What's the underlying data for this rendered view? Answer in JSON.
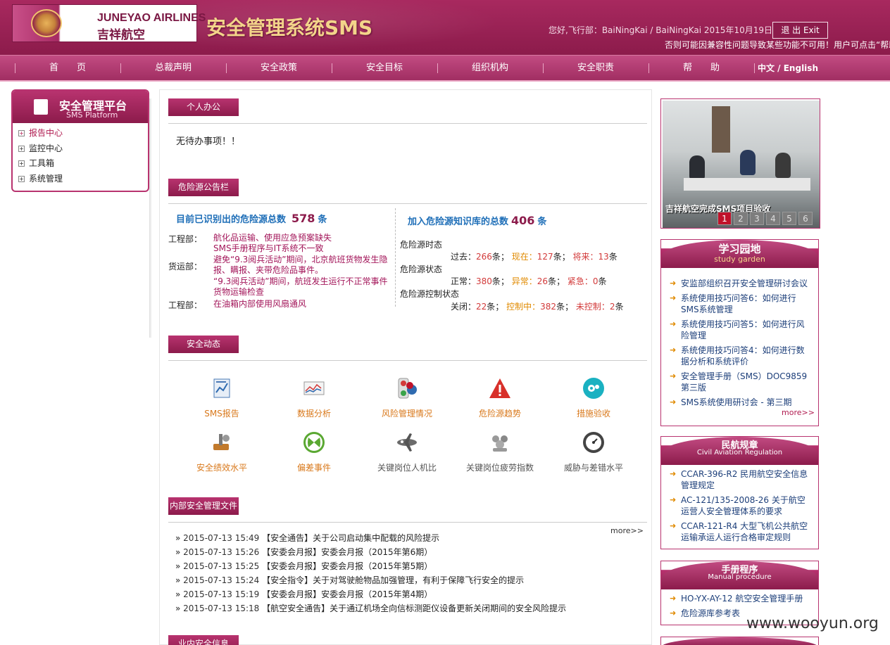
{
  "header": {
    "airline_en": "JUNEYAO AIRLINES",
    "airline_cn": "吉祥航空",
    "system_title": "安全管理系统SMS",
    "greeting": "您好,飞行部：BaiNingKai / BaiNingKai 2015年10月19日",
    "exit_label": "退 出 Exit",
    "compat_notice": "否则可能因兼容性问题导致某些功能不可用！用户可点击“帮助"
  },
  "nav": {
    "items": [
      "首　　页",
      "总裁声明",
      "安全政策",
      "安全目标",
      "组织机构",
      "安全职责",
      "帮　　助"
    ],
    "language": "中文 / English"
  },
  "sidebar": {
    "title": "安全管理平台",
    "subtitle": "SMS Platform",
    "items": [
      "报告中心",
      "监控中心",
      "工具箱",
      "系统管理"
    ]
  },
  "personal": {
    "tab": "个人办公",
    "todo_text": "无待办事项！！"
  },
  "hazard": {
    "tab": "危险源公告栏",
    "identified_label": "目前已识别出的危险源总数",
    "identified_count": "578",
    "unit": "条",
    "kb_label": "加入危险源知识库的总数",
    "kb_count": "406",
    "entries": [
      {
        "dept": "工程部：",
        "lines": [
          "航化品运输、使用应急预案缺失",
          "SMS手册程序与IT系统不一致"
        ]
      },
      {
        "dept": "货运部：",
        "lines": [
          "避免“9.3阅兵活动”期间，北京航班货物发生隐报、瞒报、夹带危险品事件。",
          "“9.3阅兵活动”期间，航班发生运行不正常事件货物运输检查"
        ]
      },
      {
        "dept": "工程部：",
        "lines": [
          "在油箱内部使用风扇通风"
        ]
      }
    ],
    "stats": {
      "time_label": "危险源时态",
      "time_values": {
        "past_label": "过去：",
        "past": "266",
        "now_label": "现在：",
        "now": "127",
        "future_label": "将来：",
        "future": "13",
        "suffix": "条"
      },
      "state_label": "危险源状态",
      "state_values": {
        "normal_label": "正常：",
        "normal": "380",
        "abnormal_label": "异常：",
        "abnormal": "26",
        "urgent_label": "紧急：",
        "urgent": "0",
        "suffix": "条"
      },
      "control_label": "危险源控制状态",
      "control_values": {
        "closed_label": "关闭：",
        "closed": "22",
        "controlling_label": "控制中：",
        "controlling": "382",
        "uncontrolled_label": "未控制：",
        "uncontrolled": "2",
        "suffix": "条"
      }
    }
  },
  "dynamics": {
    "tab": "安全动态",
    "icons": [
      {
        "label": "SMS报告",
        "icon": "report-icon"
      },
      {
        "label": "数据分析",
        "icon": "chart-icon"
      },
      {
        "label": "风险管理情况",
        "icon": "traffic-light-icon"
      },
      {
        "label": "危险源趋势",
        "icon": "warning-triangle-icon"
      },
      {
        "label": "措施验收",
        "icon": "gear-icon"
      },
      {
        "label": "安全绩效水平",
        "icon": "tools-icon"
      },
      {
        "label": "偏差事件",
        "icon": "butterfly-icon"
      },
      {
        "label": "关键岗位人机比",
        "icon": "airplane-icon"
      },
      {
        "label": "关键岗位疲劳指数",
        "icon": "people-icon"
      },
      {
        "label": "威胁与差错水平",
        "icon": "gauge-icon"
      }
    ]
  },
  "internal_docs": {
    "tab": "内部安全管理文件",
    "more": "more>>",
    "rows": [
      {
        "date": "2015-07-13 15:49",
        "title": "【安全通告】关于公司启动集中配载的风险提示"
      },
      {
        "date": "2015-07-13 15:26",
        "title": "【安委会月报】安委会月报（2015年第6期）"
      },
      {
        "date": "2015-07-13 15:25",
        "title": "【安委会月报】安委会月报（2015年第5期）"
      },
      {
        "date": "2015-07-13 15:24",
        "title": "【安全指令】关于对驾驶舱物品加强管理，有利于保障飞行安全的提示"
      },
      {
        "date": "2015-07-13 15:19",
        "title": "【安委会月报】安委会月报（2015年第4期）"
      },
      {
        "date": "2015-07-13 15:18",
        "title": "【航空安全通告】关于通辽机场全向信标测距仪设备更新关闭期间的安全风险提示"
      }
    ],
    "next_tab": "业内安全信息"
  },
  "photo": {
    "caption": "吉祥航空完成SMS项目验收",
    "pages": [
      "1",
      "2",
      "3",
      "4",
      "5",
      "6"
    ],
    "active_page": "1"
  },
  "study": {
    "title": "学习园地",
    "subtitle": "study garden",
    "items": [
      "安监部组织召开安全管理研讨会议",
      "系统使用技巧问答6：如何进行SMS系统管理",
      "系统使用技巧问答5：如何进行风险管理",
      "系统使用技巧问答4：如何进行数据分析和系统评价",
      "安全管理手册（SMS）DOC9859第三版",
      "SMS系统使用研讨会 - 第三期"
    ],
    "more": "more>>"
  },
  "regulation": {
    "title": "民航规章",
    "subtitle": "Civil Aviation Regulation",
    "items": [
      "CCAR-396-R2 民用航空安全信息管理规定",
      "AC-121/135-2008-26 关于航空运营人安全管理体系的要求",
      "CCAR-121-R4 大型飞机公共航空运输承运人运行合格审定规则"
    ]
  },
  "manual": {
    "title": "手册程序",
    "subtitle": "Manual procedure",
    "items": [
      "HO-YX-AY-12 航空安全管理手册",
      "危险源库参考表"
    ]
  },
  "watermark": "www.wooyun.org",
  "colors": {
    "brand": "#8c1b4b",
    "accent": "#b8336f",
    "link": "#1f6fb8",
    "highlight": "#e08a00"
  }
}
